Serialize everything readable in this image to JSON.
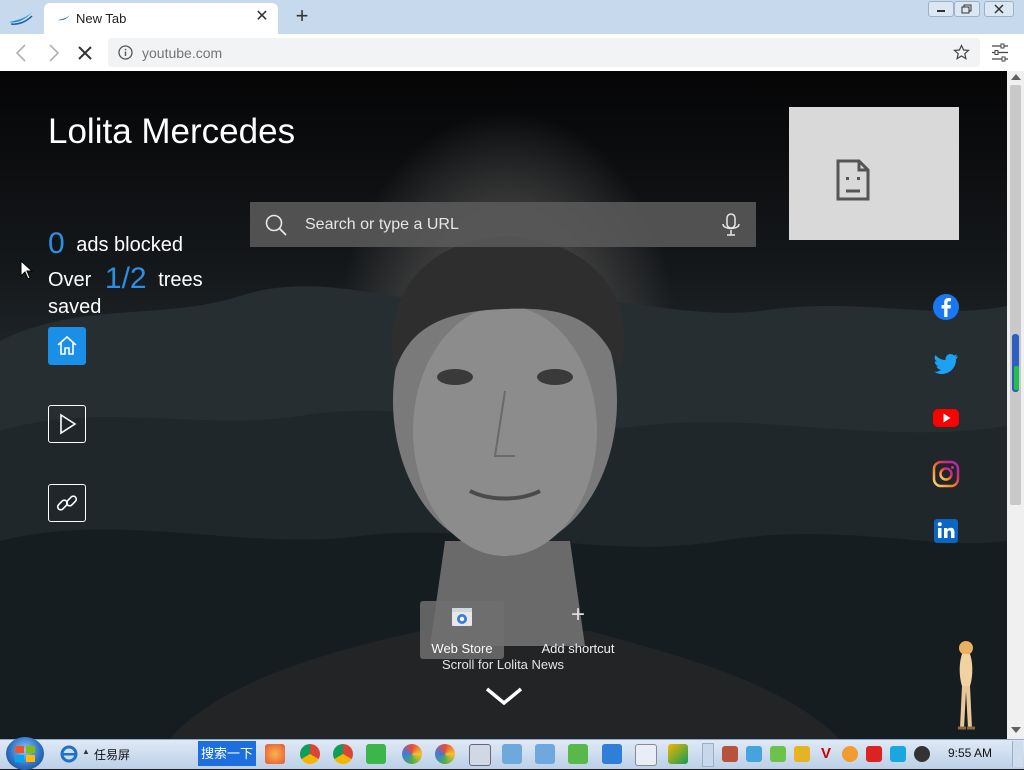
{
  "browser": {
    "tab_title": "New Tab",
    "url_placeholder": "youtube.com"
  },
  "page": {
    "user_name": "Lolita Mercedes",
    "ads_blocked_count": "0",
    "ads_blocked_label": "ads blocked",
    "trees_prefix": "Over",
    "trees_count": "1/2",
    "trees_label": "trees saved",
    "search_placeholder": "Search or type a URL",
    "shortcuts": [
      {
        "label": "Web Store"
      },
      {
        "label": "Add shortcut"
      }
    ],
    "scroll_prompt": "Scroll for Lolita News",
    "accent_color": "#1a8fe8"
  },
  "social_icons": [
    "facebook-icon",
    "twitter-icon",
    "youtube-icon",
    "instagram-icon",
    "linkedin-icon"
  ],
  "taskbar": {
    "ie_label": "任易屏",
    "search_button": "搜索一下",
    "clock": "9:55 AM"
  }
}
